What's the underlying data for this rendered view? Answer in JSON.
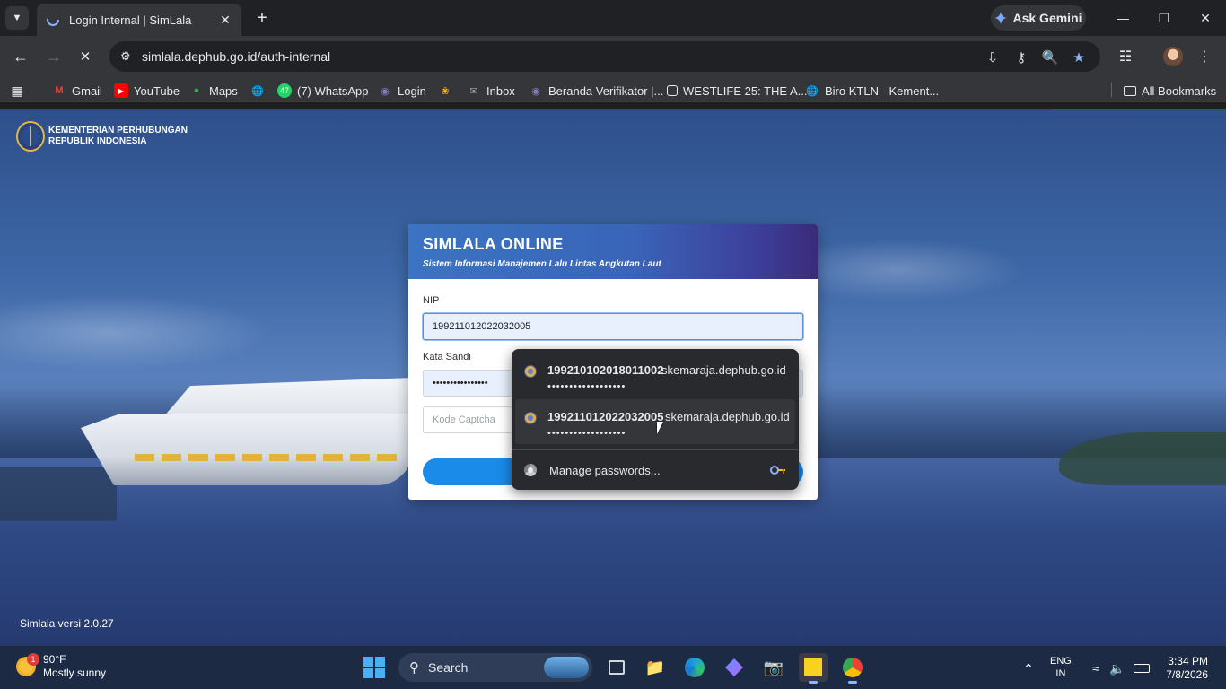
{
  "browser": {
    "tab": {
      "title": "Login Internal | SimLala"
    },
    "gemini_label": "Ask Gemini",
    "url": {
      "host": "simlala.dephub.go.id",
      "path": "/auth-internal"
    },
    "bookmarks": [
      {
        "label": "Gmail",
        "icon": "gmail-icon",
        "color": "#ea4335"
      },
      {
        "label": "YouTube",
        "icon": "youtube-icon",
        "color": "#ff0000"
      },
      {
        "label": "Maps",
        "icon": "maps-icon",
        "color": "#34a853"
      },
      {
        "label": "",
        "icon": "globe-icon",
        "color": "#9aa0a6"
      },
      {
        "label": "(7) WhatsApp",
        "icon": "whatsapp-icon",
        "color": "#25d366",
        "badge": "47"
      },
      {
        "label": "Login",
        "icon": "simlala-icon",
        "color": "#8e7cc3"
      },
      {
        "label": "",
        "icon": "pinwheel-icon",
        "color": "#fbbc04"
      },
      {
        "label": "Inbox",
        "icon": "mail-icon",
        "color": "#9aa0a6"
      },
      {
        "label": "Beranda Verifikator |...",
        "icon": "simlala-icon",
        "color": "#8e7cc3"
      },
      {
        "label": "WESTLIFE 25: THE A...",
        "icon": "page-icon",
        "color": "#e8eaed"
      },
      {
        "label": "Biro KTLN - Kement...",
        "icon": "globe-icon",
        "color": "#9aa0a6"
      }
    ],
    "all_bookmarks": "All Bookmarks"
  },
  "page": {
    "logo_line1": "KEMENTERIAN PERHUBUNGAN",
    "logo_line2": "REPUBLIK INDONESIA",
    "version": "Simlala versi 2.0.27",
    "card": {
      "title": "SIMLALA ONLINE",
      "subtitle": "Sistem Informasi Manajemen Lalu Lintas Angkutan Laut",
      "nip_label": "NIP",
      "nip_value": "199211012022032005",
      "password_label": "Kata Sandi",
      "password_value": "••••••••••••••••",
      "captcha_placeholder": "Kode Captcha"
    }
  },
  "autofill": {
    "items": [
      {
        "user": "199210102018011002",
        "site": "skemaraja.dephub.go.id",
        "password": "••••••••••••••••••"
      },
      {
        "user": "199211012022032005",
        "site": "skemaraja.dephub.go.id",
        "password": "••••••••••••••••••"
      }
    ],
    "manage_label": "Manage passwords..."
  },
  "taskbar": {
    "weather_temp": "90°F",
    "weather_desc": "Mostly sunny",
    "weather_badge": "1",
    "search_label": "Search",
    "lang_line1": "ENG",
    "lang_line2": "IN",
    "time": "3:34 PM",
    "date": "7/8/2026"
  }
}
